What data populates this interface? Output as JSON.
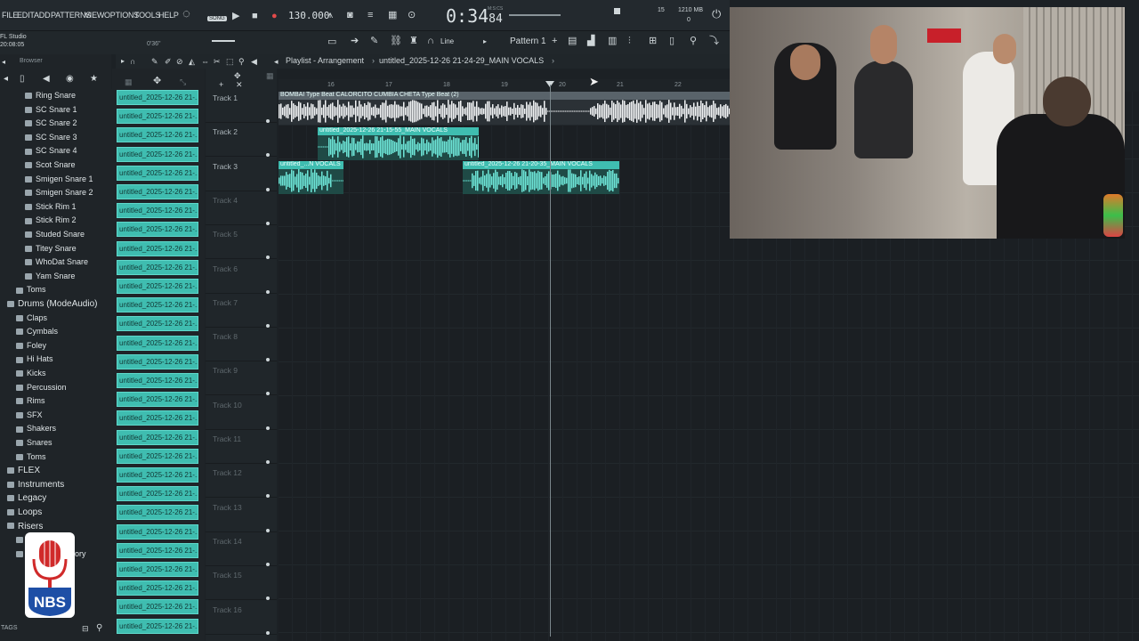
{
  "menu": [
    "FILE",
    "EDIT",
    "ADD",
    "PATTERNS",
    "VIEW",
    "OPTIONS",
    "TOOLS",
    "HELP"
  ],
  "app": {
    "name": "FL Studio",
    "clock": "20:08:05",
    "mode": "SONG",
    "tempo": "130.000",
    "time_main": "0:34",
    "time_sub": "84",
    "time_unit": "M:S:CS",
    "cpu": "15",
    "mem": "1210 MB",
    "poly": "0",
    "position": "0'36\""
  },
  "toolbar": {
    "snap": "Line",
    "pattern": "Pattern 1"
  },
  "browser": {
    "title": "Browser",
    "tags_label": "TAGS",
    "items": [
      {
        "label": "Ring Snare",
        "level": 2
      },
      {
        "label": "SC Snare 1",
        "level": 2
      },
      {
        "label": "SC Snare 2",
        "level": 2
      },
      {
        "label": "SC Snare 3",
        "level": 2
      },
      {
        "label": "SC Snare 4",
        "level": 2
      },
      {
        "label": "Scot Snare",
        "level": 2
      },
      {
        "label": "Smigen Snare 1",
        "level": 2
      },
      {
        "label": "Smigen Snare 2",
        "level": 2
      },
      {
        "label": "Stick Rim 1",
        "level": 2
      },
      {
        "label": "Stick Rim 2",
        "level": 2
      },
      {
        "label": "Studed Snare",
        "level": 2
      },
      {
        "label": "Titey Snare",
        "level": 2
      },
      {
        "label": "WhoDat Snare",
        "level": 2
      },
      {
        "label": "Yam Snare",
        "level": 2
      },
      {
        "label": "Toms",
        "level": 1
      },
      {
        "label": "Drums (ModeAudio)",
        "level": 0
      },
      {
        "label": "Claps",
        "level": 1
      },
      {
        "label": "Cymbals",
        "level": 1
      },
      {
        "label": "Foley",
        "level": 1
      },
      {
        "label": "Hi Hats",
        "level": 1
      },
      {
        "label": "Kicks",
        "level": 1
      },
      {
        "label": "Percussion",
        "level": 1
      },
      {
        "label": "Rims",
        "level": 1
      },
      {
        "label": "SFX",
        "level": 1
      },
      {
        "label": "Shakers",
        "level": 1
      },
      {
        "label": "Snares",
        "level": 1
      },
      {
        "label": "Toms",
        "level": 1
      },
      {
        "label": "FLEX",
        "level": 0
      },
      {
        "label": "Instruments",
        "level": 0
      },
      {
        "label": "Legacy",
        "level": 0
      },
      {
        "label": "Loops",
        "level": 0
      },
      {
        "label": "Risers",
        "level": 0
      },
      {
        "label": "Riser Cymbal",
        "level": 1
      },
      {
        "label": "Riser Laboratory",
        "level": 1
      }
    ]
  },
  "playlist": {
    "title": "Playlist - Arrangement",
    "file": "untitled_2025-12-26 21-24-29_MAIN VOCALS",
    "ruler": [
      "16",
      "17",
      "18",
      "19",
      "20",
      "21",
      "22"
    ],
    "clip_name": "untitled_2025-12-26 21-...",
    "tracks": [
      "Track 1",
      "Track 2",
      "Track 3",
      "Track 4",
      "Track 5",
      "Track 6",
      "Track 7",
      "Track 8",
      "Track 9",
      "Track 10",
      "Track 11",
      "Track 12",
      "Track 13",
      "Track 14",
      "Track 15",
      "Track 16"
    ],
    "clips": [
      {
        "name": "BOMBAI Type Beat CALORCITO CUMBIA CHETA Type Beat (2)",
        "color": "#d9d9d9"
      },
      {
        "name": "untitled_2025-12-26 21-15-55_MAIN VOCALS",
        "color": "#3fbdb0"
      },
      {
        "name": "untitled_...N VOCALS",
        "color": "#3fbdb0"
      },
      {
        "name": "untitled_2025-12-26 21-20-35_MAIN VOCALS",
        "color": "#3fbdb0"
      }
    ]
  },
  "overlay": {
    "logo_text": "NBS"
  }
}
